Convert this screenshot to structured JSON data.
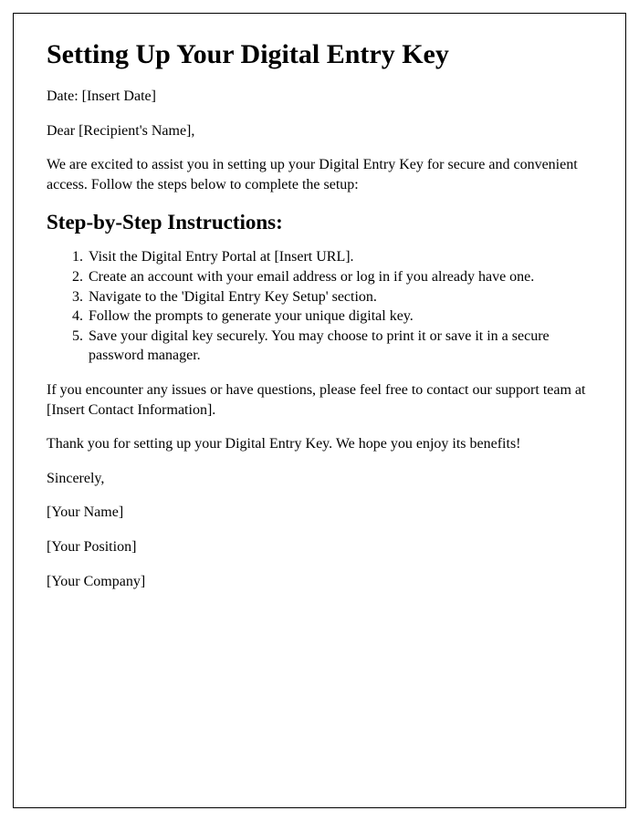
{
  "title": "Setting Up Your Digital Entry Key",
  "date_line": "Date: [Insert Date]",
  "salutation": "Dear [Recipient's Name],",
  "intro": "We are excited to assist you in setting up your Digital Entry Key for secure and convenient access. Follow the steps below to complete the setup:",
  "steps_heading": "Step-by-Step Instructions:",
  "steps": [
    "Visit the Digital Entry Portal at [Insert URL].",
    "Create an account with your email address or log in if you already have one.",
    "Navigate to the 'Digital Entry Key Setup' section.",
    "Follow the prompts to generate your unique digital key.",
    "Save your digital key securely. You may choose to print it or save it in a secure password manager."
  ],
  "support": "If you encounter any issues or have questions, please feel free to contact our support team at [Insert Contact Information].",
  "thanks": "Thank you for setting up your Digital Entry Key. We hope you enjoy its benefits!",
  "closing": "Sincerely,",
  "signature": {
    "name": "[Your Name]",
    "position": "[Your Position]",
    "company": "[Your Company]"
  }
}
